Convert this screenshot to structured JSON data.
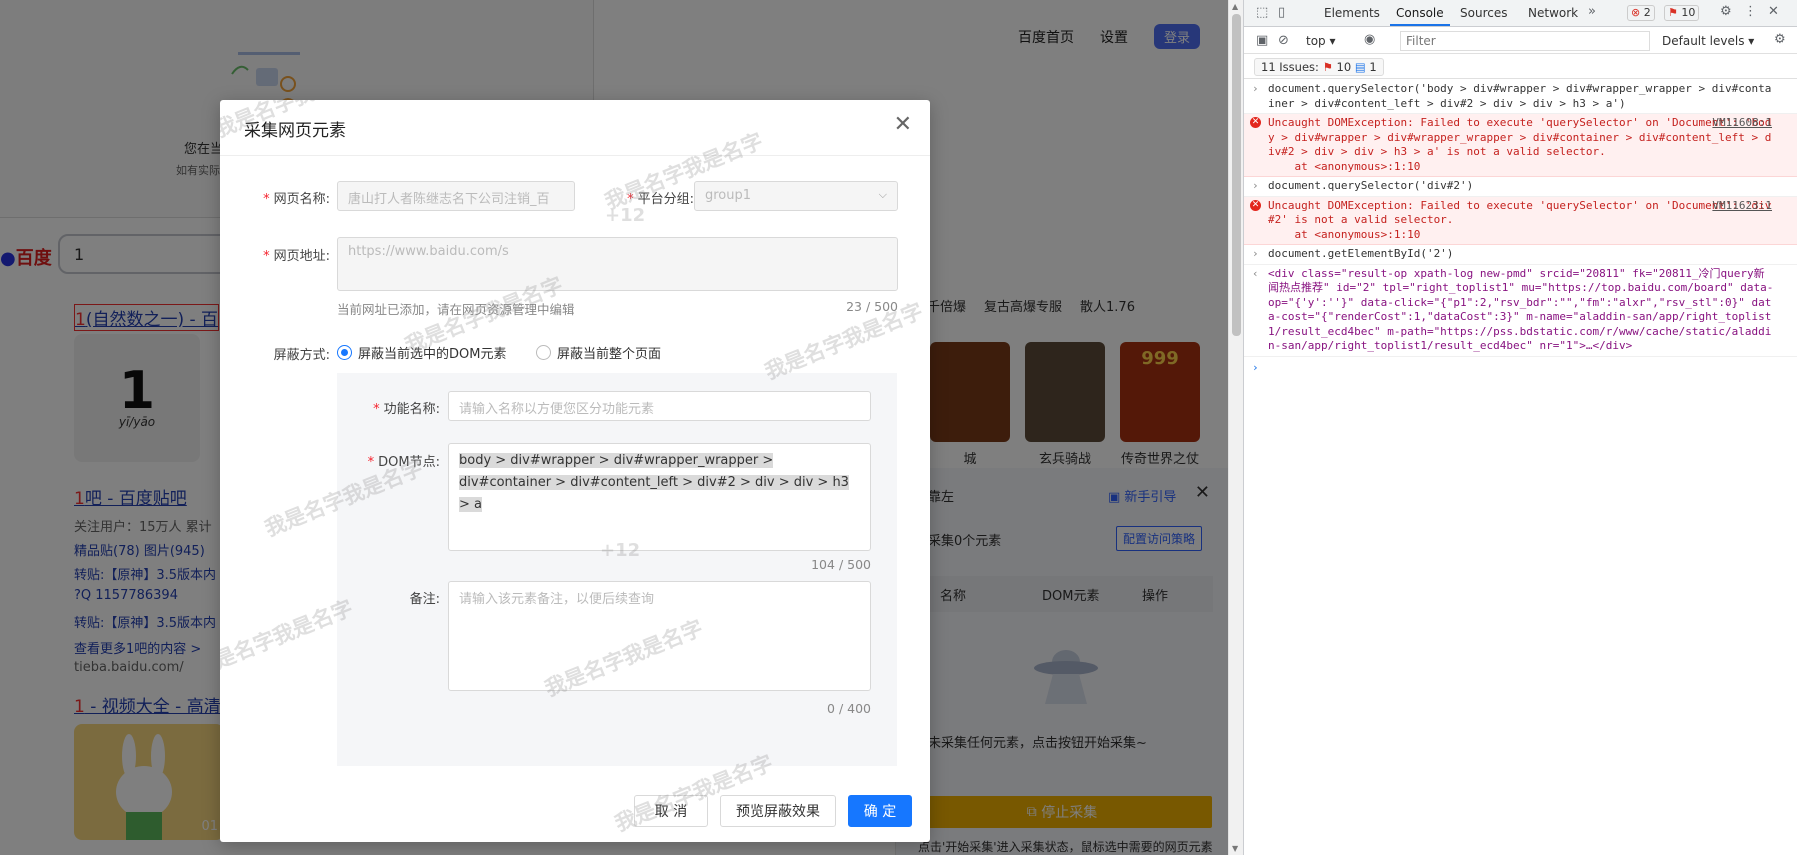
{
  "baidu": {
    "topnav": [
      "百度首页",
      "设置",
      "登录"
    ],
    "notice_text": "您在当",
    "notice_sub": "如有实际",
    "logo": "百度",
    "search_value": "1",
    "result1_title_em": "1",
    "result1_title_rest": "(自然数之一) - 百",
    "thumb_big": "1",
    "thumb_pin": "yī/yāo",
    "tieba_title_em": "1",
    "tieba_title_rest": "吧 - 百度贴吧",
    "tieba_meta": "关注用户：15万人   累计",
    "tieba_links": "精品贴(78)   图片(945)",
    "tieba_repost1": "转贴:【原神】3.5版本内",
    "tieba_qq": "?Q 1157786394",
    "tieba_repost2": "转贴:【原神】3.5版本内",
    "tieba_more": "查看更多1吧的内容 >",
    "tieba_url": "tieba.baidu.com/",
    "result3_title_em": "1",
    "result3_title_rest": " - 视频大全 - 高清",
    "video_duration": "01",
    "hot_line": [
      "千倍爆",
      "复古高爆专服",
      "散人1.76"
    ],
    "games": [
      {
        "name": "城",
        "color": "#7a3b18"
      },
      {
        "name": "玄兵骑战",
        "color": "#5c4a38"
      },
      {
        "name": "传奇世界之仗",
        "color": "#a83010"
      }
    ],
    "game_badge": "999"
  },
  "collect_panel": {
    "head": "靠左",
    "guide": "新手引导",
    "count": "采集0个元素",
    "strategy": "配置访问策略",
    "columns": [
      "名称",
      "DOM元素",
      "操作"
    ],
    "empty": "未采集任何元素，点击按钮开始采集~",
    "stop": "停止采集",
    "hint": "点击'开始采集'进入采集状态，鼠标选中需要的网页元素"
  },
  "modal": {
    "title": "采集网页元素",
    "page_name_label": "网页名称:",
    "page_name_value": "唐山打人者陈继志名下公司注销_百",
    "group_label": "平台分组:",
    "group_value": "group1",
    "url_label": "网页地址:",
    "url_value": "https://www.baidu.com/s",
    "url_help": "当前网址已添加，请在网页资源管理中编辑",
    "url_counter": "23 / 500",
    "shield_label": "屏蔽方式:",
    "shield_opt1": "屏蔽当前选中的DOM元素",
    "shield_opt2": "屏蔽当前整个页面",
    "func_label": "功能名称:",
    "func_placeholder": "请输入名称以方便您区分功能元素",
    "dom_label": "DOM节点:",
    "dom_value": "body > div#wrapper > div#wrapper_wrapper > div#container > div#content_left > div#2 > div > div > h3 > a",
    "dom_counter": "104 / 500",
    "remark_label": "备注:",
    "remark_placeholder": "请输入该元素备注，以便后续查询",
    "remark_counter": "0 / 400",
    "btn_cancel": "取 消",
    "btn_preview": "预览屏蔽效果",
    "btn_ok": "确 定"
  },
  "watermark": {
    "text": "我是名字我是名字",
    "sub": "+12"
  },
  "devtools": {
    "tabs": [
      "Elements",
      "Console",
      "Sources",
      "Network"
    ],
    "error_badge": "2",
    "warn_badge": "10",
    "context": "top",
    "filter_placeholder": "Filter",
    "levels": "Default levels",
    "issues": "11 Issues:",
    "issues_err": "10",
    "issues_info": "1",
    "lines": [
      {
        "type": "in",
        "text": "document.querySelector('body > div#wrapper > div#wrapper_wrapper > div#container > div#content_left > div#2 > div > div > h3 > a')"
      },
      {
        "type": "err",
        "src": "VM11608:1",
        "text": "Uncaught DOMException: Failed to execute 'querySelector' on 'Document': 'body > div#wrapper > div#wrapper_wrapper > div#container > div#content_left > div#2 > div > div > h3 > a' is not a valid selector.\n    at <anonymous>:1:10"
      },
      {
        "type": "in",
        "text": "document.querySelector('div#2')"
      },
      {
        "type": "err",
        "src": "VM11623:1",
        "text": "Uncaught DOMException: Failed to execute 'querySelector' on 'Document': 'div#2' is not a valid selector.\n    at <anonymous>:1:10"
      },
      {
        "type": "in",
        "text": "document.getElementById('2')"
      },
      {
        "type": "out",
        "text": "<div class=\"result-op xpath-log new-pmd\" srcid=\"20811\" fk=\"20811_冷门query新闻热点推荐\" id=\"2\" tpl=\"right_toplist1\" mu=\"https://top.baidu.com/board\" data-op=\"{'y':''}\" data-click=\"{\"p1\":2,\"rsv_bdr\":\"\",\"fm\":\"alxr\",\"rsv_stl\":0}\" data-cost=\"{\"renderCost\":1,\"dataCost\":3}\" m-name=\"aladdin-san/app/right_toplist1/result_ecd4bec\" m-path=\"https://pss.bdstatic.com/r/www/cache/static/aladdin-san/app/right_toplist1/result_ecd4bec\" nr=\"1\">…</div>"
      }
    ]
  }
}
